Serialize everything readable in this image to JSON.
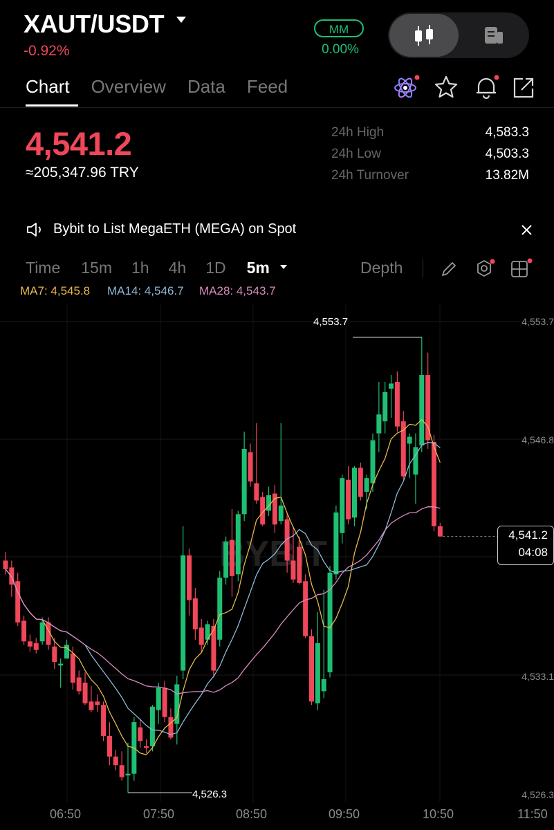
{
  "header": {
    "pair": "XAUT/USDT",
    "change_pct": "-0.92%",
    "mm_label": "MM",
    "mm_value": "0.00%"
  },
  "tabs": [
    {
      "label": "Chart",
      "active": true
    },
    {
      "label": "Overview",
      "active": false
    },
    {
      "label": "Data",
      "active": false
    },
    {
      "label": "Feed",
      "active": false
    }
  ],
  "top_icons": [
    "atom-icon",
    "star-icon",
    "bell-icon",
    "share-icon"
  ],
  "ticker": {
    "last_price": "4,541.2",
    "fiat_equiv": "≈205,347.96 TRY",
    "stats": [
      {
        "label": "24h High",
        "value": "4,583.3"
      },
      {
        "label": "24h Low",
        "value": "4,503.3"
      },
      {
        "label": "24h Turnover",
        "value": "13.82M"
      }
    ]
  },
  "announcement": {
    "text": "Bybit to  List MegaETH (MEGA) on Spot"
  },
  "intervals": {
    "items": [
      "Time",
      "15m",
      "1h",
      "4h",
      "1D",
      "5m"
    ],
    "selected": "5m",
    "depth_label": "Depth"
  },
  "ma_legend": [
    {
      "label": "MA7: 4,545.8",
      "color": "#e8b94b"
    },
    {
      "label": "MA14: 4,546.7",
      "color": "#8fb8d6"
    },
    {
      "label": "MA28: 4,543.7",
      "color": "#d98bbf"
    }
  ],
  "colors": {
    "up": "#1fbf73",
    "down": "#f0475a"
  },
  "chart_data": {
    "type": "candlestick",
    "y_ticks": [
      "4,553.7",
      "4,546.8",
      "4,533.1",
      "4,526.3"
    ],
    "x_ticks": [
      "06:50",
      "07:50",
      "08:50",
      "09:50",
      "10:50",
      "11:50"
    ],
    "ylim": [
      4526.3,
      4553.7
    ],
    "high_label": "4,553.7",
    "low_label": "4,526.3",
    "last": {
      "price": "4,541.2",
      "countdown": "04:08"
    },
    "candles": [
      [
        4539.8,
        4540.3,
        4539.0,
        4539.3
      ],
      [
        4539.4,
        4539.8,
        4537.7,
        4538.4
      ],
      [
        4538.6,
        4539.1,
        4536.0,
        4536.2
      ],
      [
        4536.3,
        4536.6,
        4534.9,
        4535.1
      ],
      [
        4535.1,
        4535.5,
        4534.5,
        4534.8
      ],
      [
        4535.0,
        4535.3,
        4534.4,
        4534.6
      ],
      [
        4535.1,
        4536.5,
        4534.9,
        4536.2
      ],
      [
        4536.2,
        4536.5,
        4534.6,
        4534.9
      ],
      [
        4534.8,
        4535.3,
        4533.5,
        4533.9
      ],
      [
        4533.7,
        4534.1,
        4532.4,
        4533.8
      ],
      [
        4534.1,
        4535.2,
        4534.1,
        4534.9
      ],
      [
        4534.4,
        4534.8,
        4532.3,
        4532.7
      ],
      [
        4533.0,
        4533.4,
        4532.0,
        4532.2
      ],
      [
        4532.7,
        4533.3,
        4531.4,
        4531.5
      ],
      [
        4531.6,
        4532.5,
        4531.0,
        4531.1
      ],
      [
        4531.6,
        4532.0,
        4531.0,
        4531.4
      ],
      [
        4531.4,
        4531.6,
        4529.3,
        4529.6
      ],
      [
        4529.6,
        4530.4,
        4527.9,
        4528.4
      ],
      [
        4528.4,
        4528.8,
        4527.6,
        4527.9
      ],
      [
        4527.9,
        4528.7,
        4527.0,
        4527.2
      ],
      [
        4527.3,
        4529.2,
        4526.3,
        4527.4
      ],
      [
        4527.4,
        4530.7,
        4527.0,
        4530.4
      ],
      [
        4530.1,
        4530.6,
        4528.9,
        4529.3
      ],
      [
        4529.0,
        4529.4,
        4528.6,
        4528.9
      ],
      [
        4529.0,
        4531.4,
        4528.7,
        4531.3
      ],
      [
        4531.1,
        4532.7,
        4530.3,
        4532.4
      ],
      [
        4532.4,
        4532.8,
        4530.4,
        4530.7
      ],
      [
        4530.7,
        4531.2,
        4529.4,
        4529.5
      ],
      [
        4530.3,
        4533.1,
        4529.1,
        4532.6
      ],
      [
        4533.4,
        4541.8,
        4532.9,
        4540.1
      ],
      [
        4540.1,
        4540.5,
        4536.6,
        4537.5
      ],
      [
        4537.6,
        4538.2,
        4535.2,
        4535.8
      ],
      [
        4535.9,
        4536.4,
        4534.5,
        4534.9
      ],
      [
        4535.2,
        4536.3,
        4534.9,
        4536.1
      ],
      [
        4536.0,
        4536.4,
        4533.0,
        4533.4
      ],
      [
        4535.2,
        4539.2,
        4534.8,
        4538.8
      ],
      [
        4538.8,
        4541.2,
        4538.4,
        4540.9
      ],
      [
        4541.0,
        4542.8,
        4537.7,
        4538.9
      ],
      [
        4539.0,
        4542.7,
        4538.6,
        4542.5
      ],
      [
        4542.5,
        4547.3,
        4542.1,
        4546.3
      ],
      [
        4546.1,
        4546.6,
        4544.1,
        4544.4
      ],
      [
        4544.3,
        4547.8,
        4543.1,
        4543.3
      ],
      [
        4543.5,
        4543.8,
        4541.8,
        4541.9
      ],
      [
        4542.7,
        4544.1,
        4542.4,
        4543.6
      ],
      [
        4543.7,
        4544.2,
        4541.4,
        4541.9
      ],
      [
        4542.1,
        4547.8,
        4541.9,
        4543.0
      ],
      [
        4542.2,
        4542.5,
        4539.1,
        4539.8
      ],
      [
        4539.8,
        4541.8,
        4538.5,
        4538.7
      ],
      [
        4540.6,
        4541.2,
        4538.4,
        4538.5
      ],
      [
        4538.6,
        4539.0,
        4535.3,
        4535.4
      ],
      [
        4535.4,
        4535.8,
        4531.4,
        4531.6
      ],
      [
        4531.5,
        4536.8,
        4531.1,
        4535.0
      ],
      [
        4532.2,
        4538.1,
        4531.8,
        4532.9
      ],
      [
        4533.3,
        4539.5,
        4533.0,
        4539.1
      ],
      [
        4539.0,
        4543.0,
        4538.7,
        4542.6
      ],
      [
        4541.4,
        4544.8,
        4540.8,
        4544.6
      ],
      [
        4544.5,
        4545.3,
        4541.9,
        4542.2
      ],
      [
        4542.3,
        4545.3,
        4541.8,
        4545.2
      ],
      [
        4545.2,
        4545.5,
        4543.3,
        4543.5
      ],
      [
        4543.8,
        4544.8,
        4542.8,
        4544.6
      ],
      [
        4544.3,
        4547.2,
        4543.8,
        4546.8
      ],
      [
        4547.2,
        4550.2,
        4546.1,
        4548.3
      ],
      [
        4547.9,
        4550.2,
        4547.2,
        4549.6
      ],
      [
        4549.8,
        4550.6,
        4548.1,
        4550.1
      ],
      [
        4550.2,
        4550.8,
        4547.3,
        4547.6
      ],
      [
        4547.9,
        4548.5,
        4544.5,
        4544.7
      ],
      [
        4546.6,
        4547.2,
        4544.6,
        4547.0
      ],
      [
        4544.8,
        4547.2,
        4543.1,
        4546.4
      ],
      [
        4546.5,
        4552.8,
        4546.1,
        4550.6
      ],
      [
        4550.6,
        4551.9,
        4546.3,
        4546.8
      ],
      [
        4546.7,
        4547.1,
        4541.5,
        4541.8
      ],
      [
        4541.8,
        4542.0,
        4541.2,
        4541.2
      ]
    ]
  }
}
